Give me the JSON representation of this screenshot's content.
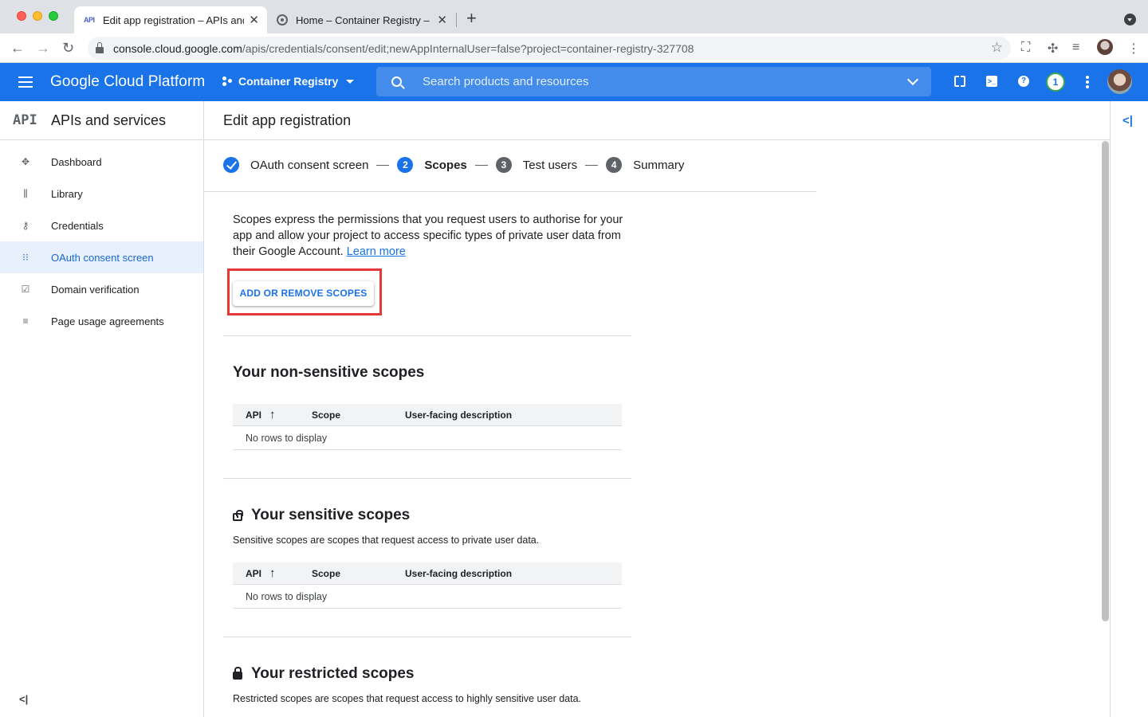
{
  "browser": {
    "tabs": [
      {
        "title": "Edit app registration – APIs and services",
        "favicon": "API"
      },
      {
        "title": "Home – Container Registry – Google Cloud Platform"
      }
    ],
    "url_host": "console.cloud.google.com",
    "url_path": "/apis/credentials/consent/edit;newAppInternalUser=false?project=container-registry-327708"
  },
  "header": {
    "title": "Google Cloud Platform",
    "project": "Container Registry",
    "search_placeholder": "Search products and resources",
    "notification_count": "1",
    "accent_color": "#1a73e8"
  },
  "sidebar": {
    "logo": "API",
    "title": "APIs and services",
    "items": [
      {
        "label": "Dashboard",
        "icon": "dashboard-icon"
      },
      {
        "label": "Library",
        "icon": "library-icon"
      },
      {
        "label": "Credentials",
        "icon": "key-icon"
      },
      {
        "label": "OAuth consent screen",
        "icon": "consent-icon",
        "active": true
      },
      {
        "label": "Domain verification",
        "icon": "checkbox-icon"
      },
      {
        "label": "Page usage agreements",
        "icon": "settings-list-icon"
      }
    ]
  },
  "main": {
    "title": "Edit app registration",
    "steps": [
      {
        "num": "1",
        "label": "OAuth consent screen",
        "state": "done"
      },
      {
        "num": "2",
        "label": "Scopes",
        "state": "current"
      },
      {
        "num": "3",
        "label": "Test users",
        "state": "upcoming"
      },
      {
        "num": "4",
        "label": "Summary",
        "state": "upcoming"
      }
    ],
    "intro_text": "Scopes express the permissions that you request users to authorise for your app and allow your project to access specific types of private user data from their Google Account.",
    "learn_more": "Learn more",
    "add_scopes_button": "ADD OR REMOVE SCOPES",
    "sections": {
      "non_sensitive": {
        "title": "Your non-sensitive scopes"
      },
      "sensitive": {
        "title": "Your sensitive scopes",
        "description": "Sensitive scopes are scopes that request access to private user data."
      },
      "restricted": {
        "title": "Your restricted scopes",
        "description": "Restricted scopes are scopes that request access to highly sensitive user data."
      }
    },
    "table_columns": {
      "api": "API",
      "scope": "Scope",
      "description": "User-facing description"
    },
    "empty_text": "No rows to display"
  }
}
